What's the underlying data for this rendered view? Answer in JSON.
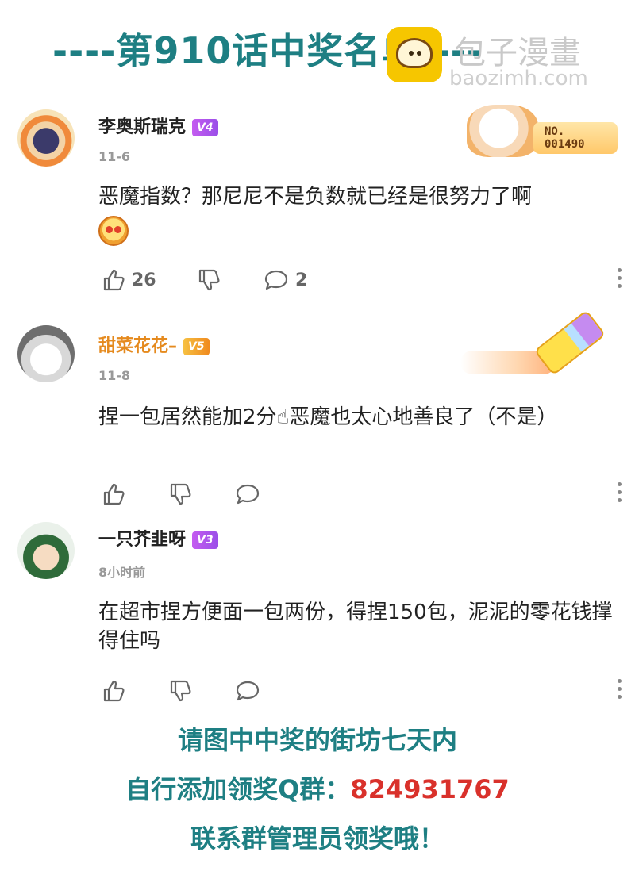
{
  "header": {
    "title": "----第910话中奖名单----",
    "watermark_text": "包子漫畫",
    "watermark_url": "baozimh.com"
  },
  "comments": [
    {
      "username": "李奥斯瑞克",
      "level": "V4",
      "date": "11-6",
      "text": "恶魔指数？那尼尼不是负数就已经是很努力了啊",
      "badge_number": "NO.\n001490",
      "likes": "26",
      "replies": "2"
    },
    {
      "username": "甜菜花花–",
      "level": "V5",
      "date": "11-8",
      "text": "捏一包居然能加2分☝恶魔也太心地善良了（不是）"
    },
    {
      "username": "一只芥韭呀",
      "level": "V3",
      "date": "8小时前",
      "text": "在超市捏方便面一包两份，得捏150包，泥泥的零花钱撑得住吗"
    }
  ],
  "footer": {
    "line1": "请图中中奖的街坊七天内",
    "line2_prefix": "自行添加领奖Q群：",
    "line2_number": "824931767",
    "line3": "联系群管理员领奖哦！"
  },
  "colors": {
    "title": "#1e7f83",
    "accent_red": "#d9312b",
    "level_purple": "#b257ee",
    "username_orange": "#e58a1e"
  },
  "icons": [
    "like-icon",
    "dislike-icon",
    "reply-icon",
    "more-icon"
  ]
}
